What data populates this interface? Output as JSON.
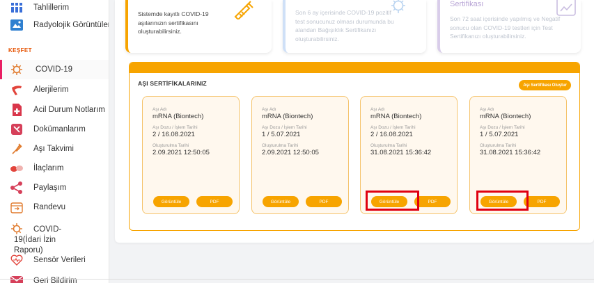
{
  "sidebar": {
    "items_top": [
      {
        "label": "Tahlillerim",
        "icon": "grid-icon"
      },
      {
        "label": "Radyolojik Görüntülerim",
        "icon": "xray-icon"
      }
    ],
    "section_label": "KEŞFET",
    "items": [
      {
        "label": "COVID-19",
        "icon": "virus-icon"
      },
      {
        "label": "Alerjilerim",
        "icon": "allergy-icon"
      },
      {
        "label": "Acil Durum Notlarım",
        "icon": "emergency-note-icon"
      },
      {
        "label": "Dokümanlarım",
        "icon": "documents-icon"
      },
      {
        "label": "Aşı Takvimi",
        "icon": "vaccine-calendar-icon"
      },
      {
        "label": "İlaçlarım",
        "icon": "pills-icon"
      },
      {
        "label": "Paylaşım",
        "icon": "share-icon"
      },
      {
        "label": "Randevu",
        "icon": "appointment-icon"
      },
      {
        "label": "COVID-19(İdari İzin Raporu)",
        "icon": "virus-icon"
      },
      {
        "label": "Sensör Verileri",
        "icon": "heart-sensor-icon"
      },
      {
        "label": "Geri Bildirim",
        "icon": "feedback-icon"
      }
    ]
  },
  "info_cards": [
    {
      "title": "",
      "text": "Sistemde kayıtlı COVID-19 aşılarınızın sertifikasını oluşturabilirsiniz."
    },
    {
      "title": "",
      "text": "Son 6 ay içerisinde COVID-19 pozitif test sonucunuz olması durumunda bu alandan Bağışıklık Sertifikanızı oluşturabilirsiniz."
    },
    {
      "title": "Sertifikası",
      "text": "Son 72 saat içerisinde yapılmış ve Negatif sonucu olan COVID-19 testleri için Test Sertifikanızı oluşturabilirsiniz."
    }
  ],
  "certificates": {
    "title": "AŞI SERTİFİKALARINIZ",
    "create_button": "Aşı Sertifikası Oluştur",
    "field_labels": {
      "vaccine": "Aşı Adı",
      "dose": "Aşı Dozu / İşlem Tarihi",
      "created": "Oluşturulma Tarihi"
    },
    "view_label": "Görüntüle",
    "pdf_label": "PDF",
    "items": [
      {
        "vaccine": "mRNA (Biontech)",
        "dose": "2 / 16.08.2021",
        "created": "2.09.2021 12:50:05"
      },
      {
        "vaccine": "mRNA (Biontech)",
        "dose": "1 / 5.07.2021",
        "created": "2.09.2021 12:50:05"
      },
      {
        "vaccine": "mRNA (Biontech)",
        "dose": "2 / 16.08.2021",
        "created": "31.08.2021 15:36:42"
      },
      {
        "vaccine": "mRNA (Biontech)",
        "dose": "1 / 5.07.2021",
        "created": "31.08.2021 15:36:42"
      }
    ]
  },
  "colors": {
    "accent": "#f7a400",
    "active": "#e91e63",
    "highlight": "#e00010"
  }
}
